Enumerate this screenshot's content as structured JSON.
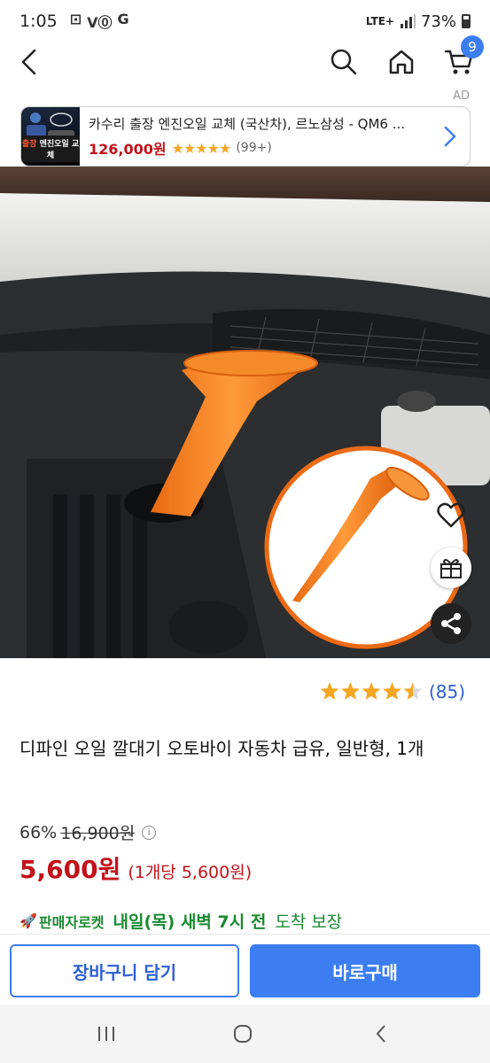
{
  "status_bar": {
    "time": "1:05",
    "notification_icons": [
      "voicemail-icon",
      "volte-icon",
      "g-icon"
    ],
    "network": "LTE+",
    "battery": "73%"
  },
  "nav": {
    "cart_count": "9"
  },
  "ad": {
    "label": "AD",
    "title": "카수리 출장 엔진오일 교체 (국산차), 르노삼성 - QM6 ...",
    "thumb_prefix": "출장",
    "thumb_text": "엔진오일 교체",
    "price": "126,000원",
    "stars": "★★★★★",
    "review_count": "(99+)"
  },
  "product": {
    "rating_value": 4.5,
    "review_count": "(85)",
    "title": "디파인 오일 깔대기 오토바이 자동차 급유, 일반형, 1개",
    "discount_rate": "66%",
    "original_price": "16,900원",
    "sale_price": "5,600원",
    "unit_price": "(1개당 5,600원)"
  },
  "delivery": {
    "rocket_label": "판매자로켓",
    "arrival_day": "내일(목) 새벽 7시 전",
    "arrival_rest": "도착 보장"
  },
  "actions": {
    "add_to_cart": "장바구니 담기",
    "buy_now": "바로구매"
  },
  "colors": {
    "accent_blue": "#3c7df1",
    "price_red": "#c2121a",
    "rocket_green": "#1a8a30",
    "star_yellow": "#f5a623",
    "funnel_orange": "#f07820"
  }
}
